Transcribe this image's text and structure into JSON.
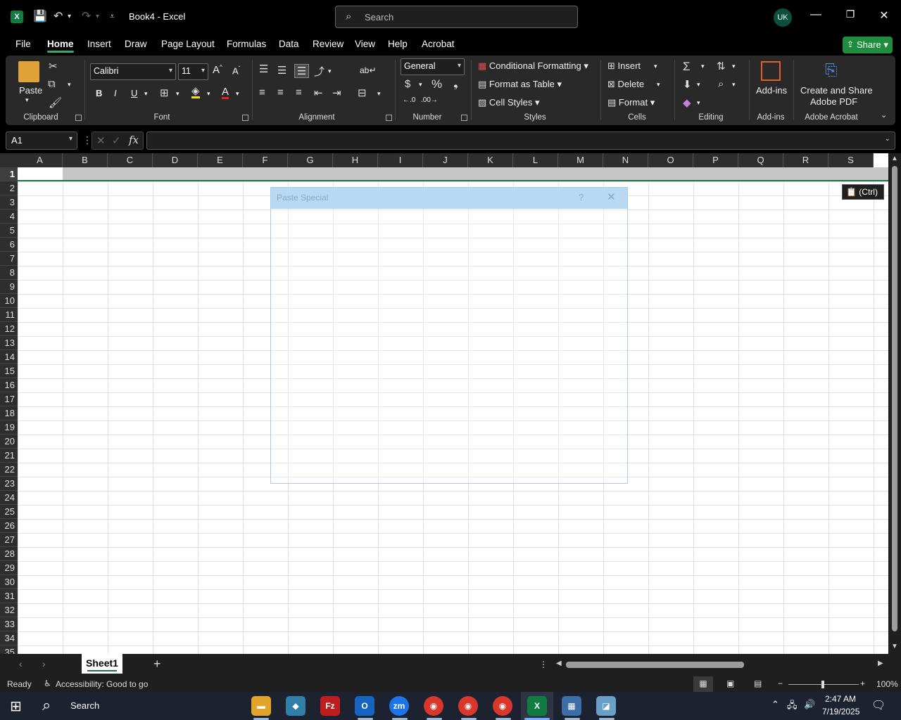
{
  "titlebar": {
    "doc_title": "Book4  -  Excel",
    "search_placeholder": "Search",
    "avatar_initials": "UK"
  },
  "menu": {
    "tabs": [
      "File",
      "Home",
      "Insert",
      "Draw",
      "Page Layout",
      "Formulas",
      "Data",
      "Review",
      "View",
      "Help",
      "Acrobat"
    ],
    "active_tab": "Home",
    "share_label": "Share"
  },
  "ribbon": {
    "clipboard": {
      "label": "Clipboard",
      "paste": "Paste"
    },
    "font": {
      "label": "Font",
      "name": "Calibri",
      "size": "11",
      "bold": "B",
      "italic": "I",
      "underline": "U"
    },
    "alignment": {
      "label": "Alignment"
    },
    "number": {
      "label": "Number",
      "format": "General"
    },
    "styles": {
      "label": "Styles",
      "conditional": "Conditional Formatting",
      "format_table": "Format as Table",
      "cell_styles": "Cell Styles"
    },
    "cells": {
      "label": "Cells",
      "insert": "Insert",
      "delete": "Delete",
      "format": "Format"
    },
    "editing": {
      "label": "Editing"
    },
    "addins": {
      "label": "Add-ins",
      "button": "Add-ins"
    },
    "acrobat": {
      "label": "Adobe Acrobat",
      "button_line1": "Create and Share",
      "button_line2": "Adobe PDF"
    }
  },
  "formula_bar": {
    "name_box": "A1",
    "fx": "fx",
    "content": ""
  },
  "sheet": {
    "columns": [
      "A",
      "B",
      "C",
      "D",
      "E",
      "F",
      "G",
      "H",
      "I",
      "J",
      "K",
      "L",
      "M",
      "N",
      "O",
      "P",
      "Q",
      "R",
      "S"
    ],
    "rows": [
      "1",
      "2",
      "3",
      "4",
      "5",
      "6",
      "7",
      "8",
      "9",
      "10",
      "11",
      "12",
      "13",
      "14",
      "15",
      "16",
      "17",
      "18",
      "19",
      "20",
      "21",
      "22",
      "23",
      "24",
      "25",
      "26",
      "27",
      "28",
      "29",
      "30",
      "31",
      "32",
      "33",
      "34",
      "35"
    ],
    "paste_options_tag": "(Ctrl)"
  },
  "dialog": {
    "title": "Paste Special",
    "help": "?",
    "close": "✕"
  },
  "sheet_tabs": {
    "active": "Sheet1",
    "add": "+"
  },
  "status": {
    "ready": "Ready",
    "accessibility": "Accessibility: Good to go",
    "zoom": "100%"
  },
  "taskbar": {
    "search": "Search",
    "time": "2:47 AM",
    "date": "7/19/2025"
  }
}
